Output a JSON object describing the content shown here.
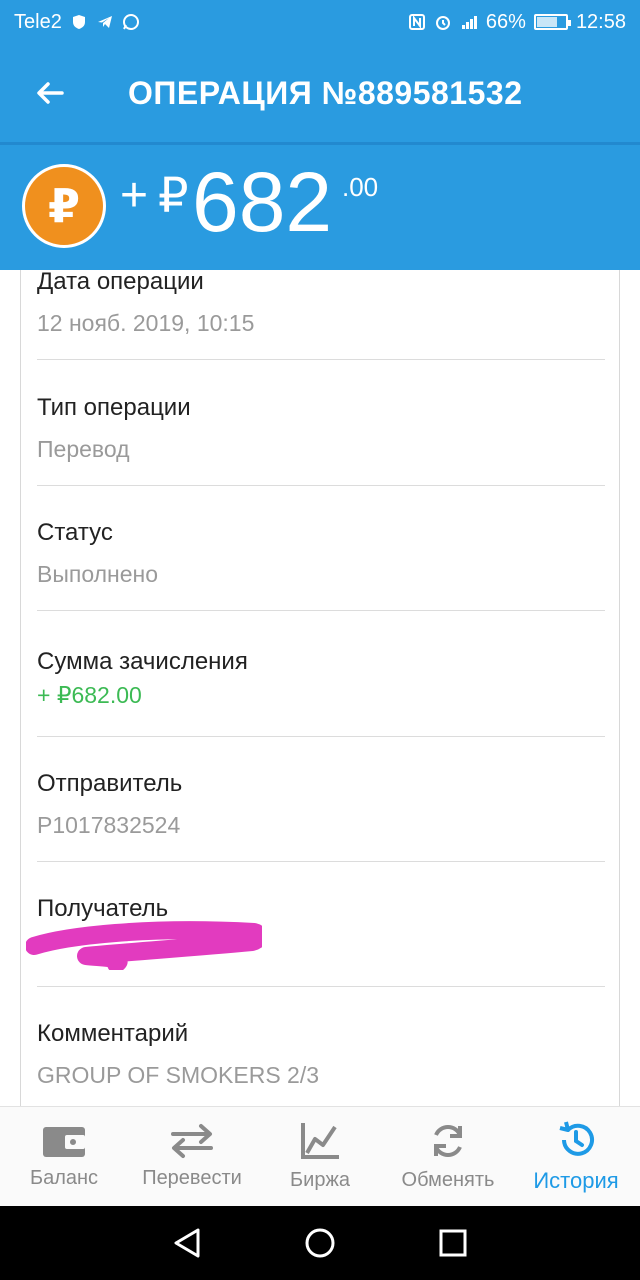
{
  "status_bar": {
    "carrier": "Tele2",
    "battery": "66%",
    "battery_level": 0.66,
    "time": "12:58"
  },
  "header": {
    "title": "ОПЕРАЦИЯ №889581532",
    "back_icon": "arrow-left-icon"
  },
  "amount": {
    "sign": "+",
    "currency_symbol": "₽",
    "main": "682",
    "cents": ".00",
    "coin_letter": "₽",
    "coin_color": "#f0901e"
  },
  "details": [
    {
      "label": "Дата операции",
      "value": "12 нояб. 2019, 10:15"
    },
    {
      "label": "Тип операции",
      "value": "Перевод"
    },
    {
      "label": "Статус",
      "value": "Выполнено"
    },
    {
      "label": "Сумма зачисления",
      "value": "+ ₽682.00"
    },
    {
      "label": "Отправитель",
      "value": "P1017832524"
    },
    {
      "label": "Получатель",
      "value": ""
    },
    {
      "label": "Комментарий",
      "value": "GROUP OF SMOKERS 2/3"
    }
  ],
  "bottom_nav": [
    {
      "label": "Баланс",
      "icon": "wallet-icon",
      "active": false
    },
    {
      "label": "Перевести",
      "icon": "transfer-arrows-icon",
      "active": false
    },
    {
      "label": "Биржа",
      "icon": "chart-icon",
      "active": false
    },
    {
      "label": "Обменять",
      "icon": "refresh-icon",
      "active": false
    },
    {
      "label": "История",
      "icon": "history-icon",
      "active": true
    }
  ],
  "colors": {
    "primary": "#2a9be0",
    "accent_active": "#1e9ae6",
    "positive": "#3cba54",
    "redaction": "#e23bbf"
  }
}
